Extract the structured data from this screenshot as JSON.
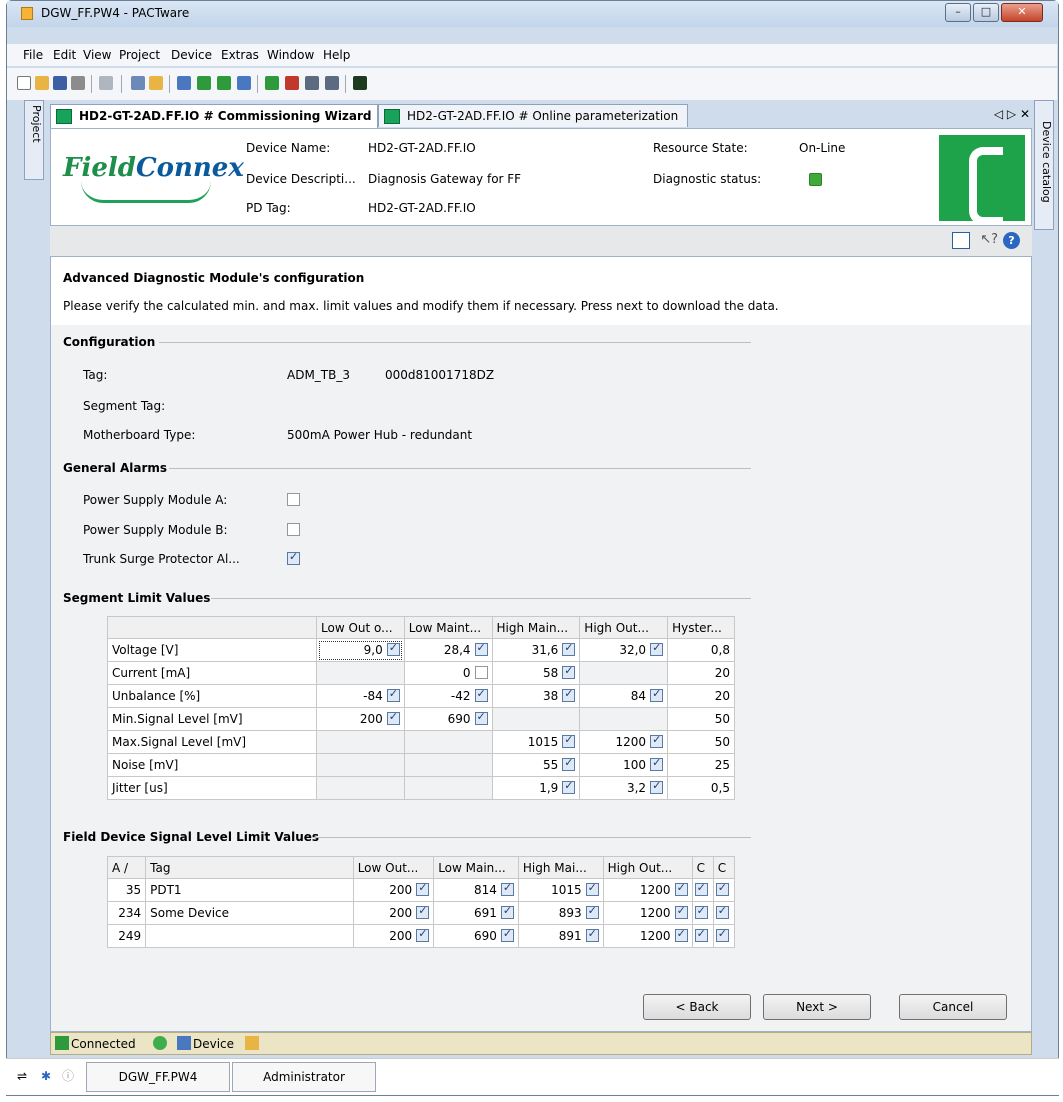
{
  "window": {
    "title": "DGW_FF.PW4 - PACTware"
  },
  "menu": [
    "File",
    "Edit",
    "View",
    "Project",
    "Device",
    "Extras",
    "Window",
    "Help"
  ],
  "side": {
    "project": "Project",
    "device_catalog": "Device catalog"
  },
  "tabs": [
    {
      "label": "HD2-GT-2AD.FF.IO # Commissioning Wizard",
      "active": true
    },
    {
      "label": "HD2-GT-2AD.FF.IO # Online parameterization",
      "active": false
    }
  ],
  "header": {
    "logo_a": "Field",
    "logo_b": "Connex",
    "device_name_label": "Device Name:",
    "device_name": "HD2-GT-2AD.FF.IO",
    "device_desc_label": "Device Descripti...",
    "device_desc": "Diagnosis Gateway for FF",
    "pd_tag_label": "PD Tag:",
    "pd_tag": "HD2-GT-2AD.FF.IO",
    "resource_state_label": "Resource State:",
    "resource_state": "On-Line",
    "diag_status_label": "Diagnostic status:"
  },
  "intro": {
    "heading": "Advanced Diagnostic Module's configuration",
    "text": "Please verify the calculated min. and max. limit values and modify them if necessary. Press next to download the data."
  },
  "configuration": {
    "title": "Configuration",
    "tag_label": "Tag:",
    "tag": "ADM_TB_3",
    "tag_id": "000d81001718DZ",
    "segment_tag_label": "Segment Tag:",
    "motherboard_label": "Motherboard Type:",
    "motherboard": "500mA Power Hub - redundant"
  },
  "alarms": {
    "title": "General Alarms",
    "items": [
      {
        "label": "Power Supply Module A:",
        "checked": false
      },
      {
        "label": "Power Supply Module B:",
        "checked": false
      },
      {
        "label": "Trunk Surge Protector Al...",
        "checked": true
      }
    ]
  },
  "segment": {
    "title": "Segment Limit Values",
    "columns": [
      "",
      "Low Out o...",
      "Low Maint...",
      "High Main...",
      "High Out...",
      "Hyster..."
    ],
    "rows": [
      {
        "name": "Voltage [V]",
        "cells": [
          [
            "9,0",
            true
          ],
          [
            "28,4",
            true
          ],
          [
            "31,6",
            true
          ],
          [
            "32,0",
            true
          ]
        ],
        "hyst": "0,8"
      },
      {
        "name": "Current [mA]",
        "cells": [
          null,
          [
            "0",
            false
          ],
          [
            "58",
            true
          ],
          null
        ],
        "hyst": "20"
      },
      {
        "name": "Unbalance [%]",
        "cells": [
          [
            "-84",
            true
          ],
          [
            "-42",
            true
          ],
          [
            "38",
            true
          ],
          [
            "84",
            true
          ]
        ],
        "hyst": "20"
      },
      {
        "name": "Min.Signal Level [mV]",
        "cells": [
          [
            "200",
            true
          ],
          [
            "690",
            true
          ],
          null,
          null
        ],
        "hyst": "50"
      },
      {
        "name": "Max.Signal Level [mV]",
        "cells": [
          null,
          null,
          [
            "1015",
            true
          ],
          [
            "1200",
            true
          ]
        ],
        "hyst": "50"
      },
      {
        "name": "Noise [mV]",
        "cells": [
          null,
          null,
          [
            "55",
            true
          ],
          [
            "100",
            true
          ]
        ],
        "hyst": "25"
      },
      {
        "name": "Jitter [us]",
        "cells": [
          null,
          null,
          [
            "1,9",
            true
          ],
          [
            "3,2",
            true
          ]
        ],
        "hyst": "0,5"
      }
    ]
  },
  "field": {
    "title": "Field Device Signal Level Limit Values",
    "columns": [
      "A",
      "Tag",
      "Low Out...",
      "Low Main...",
      "High Mai...",
      "High Out...",
      "C",
      "C"
    ],
    "rows": [
      {
        "a": "35",
        "tag": "PDT1",
        "v": [
          "200",
          "814",
          "1015",
          "1200"
        ]
      },
      {
        "a": "234",
        "tag": "Some Device",
        "v": [
          "200",
          "691",
          "893",
          "1200"
        ]
      },
      {
        "a": "249",
        "tag": "",
        "v": [
          "200",
          "690",
          "891",
          "1200"
        ]
      }
    ]
  },
  "buttons": {
    "back": "< Back",
    "next": "Next >",
    "cancel": "Cancel"
  },
  "status": {
    "connected": "Connected",
    "device": "Device"
  },
  "taskbar": {
    "project": "DGW_FF.PW4",
    "user": "Administrator"
  }
}
